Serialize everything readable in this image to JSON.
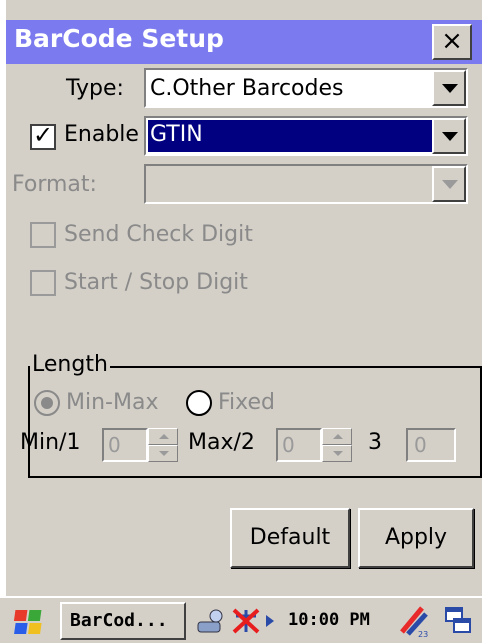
{
  "window": {
    "title": "BarCode Setup",
    "close_label": "×"
  },
  "form": {
    "type_label": "Type:",
    "type_value": "C.Other Barcodes",
    "enable_label": "Enable",
    "enable_checked": true,
    "enable_value": "GTIN",
    "format_label": "Format:",
    "format_value": "",
    "send_check_digit_label": "Send Check Digit",
    "start_stop_digit_label": "Start / Stop Digit"
  },
  "length_group": {
    "title": "Length",
    "min_max_label": "Min-Max",
    "fixed_label": "Fixed",
    "min_label": "Min/1",
    "min_value": "0",
    "max_label": "Max/2",
    "max_value": "0",
    "third_label": "3",
    "third_value": "0"
  },
  "buttons": {
    "default_label": "Default",
    "apply_label": "Apply"
  },
  "taskbar": {
    "task_label": "BarCod...",
    "time": "10:00 PM",
    "icons": [
      "windows-flag-icon",
      "network-icon",
      "no-signal-icon",
      "arrow-icon",
      "pen-input-icon",
      "windows-switch-icon"
    ]
  },
  "colors": {
    "title_bar": "#7b7bef",
    "selection": "#000080",
    "dialog_bg": "#d4d0c8"
  }
}
